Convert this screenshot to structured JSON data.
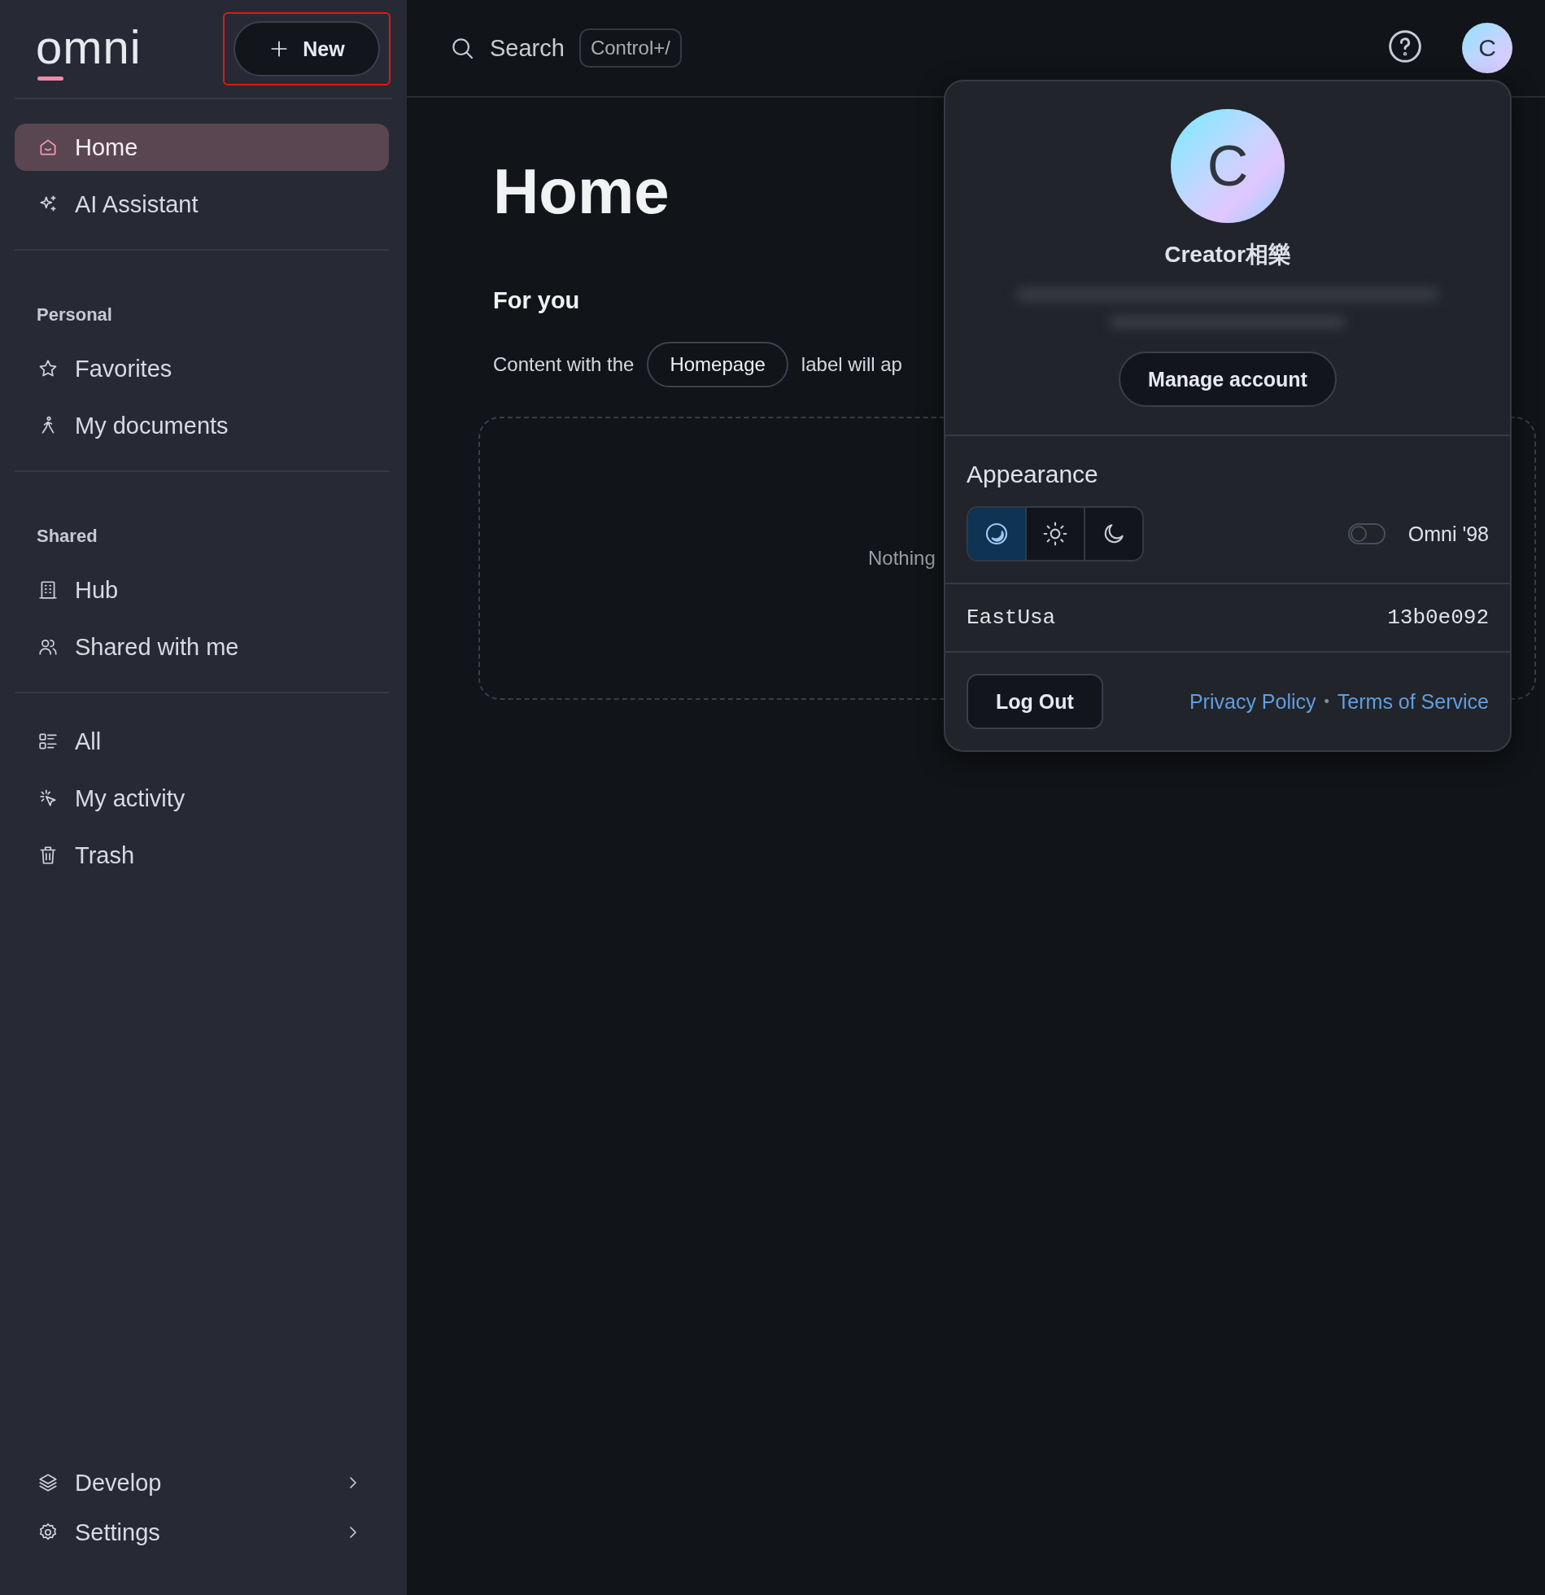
{
  "logo": {
    "text": "omni"
  },
  "new_button": {
    "label": "New",
    "highlighted": true
  },
  "search": {
    "label": "Search",
    "shortcut": "Control+/"
  },
  "user_avatar": {
    "initial": "C"
  },
  "sidebar": {
    "sections": [
      {
        "items": [
          {
            "label": "Home",
            "selected": true
          },
          {
            "label": "AI Assistant",
            "selected": false
          }
        ]
      },
      {
        "heading": "Personal",
        "items": [
          {
            "label": "Favorites",
            "selected": false
          },
          {
            "label": "My documents",
            "selected": false
          }
        ]
      },
      {
        "heading": "Shared",
        "items": [
          {
            "label": "Hub",
            "selected": false
          },
          {
            "label": "Shared with me",
            "selected": false
          }
        ]
      },
      {
        "items": [
          {
            "label": "All",
            "selected": false
          },
          {
            "label": "My activity",
            "selected": false
          },
          {
            "label": "Trash",
            "selected": false
          }
        ]
      }
    ],
    "footer_items": [
      {
        "label": "Develop",
        "expanded": false
      },
      {
        "label": "Settings",
        "expanded": false
      }
    ]
  },
  "main": {
    "title": "Home",
    "section_title": "For you",
    "hint_before": "Content with the",
    "hint_label": "Homepage",
    "hint_after": "label will ap",
    "empty_text": "Nothing"
  },
  "account_menu": {
    "avatar_initial": "C",
    "name": "Creator相樂",
    "manage_button": "Manage account",
    "appearance": {
      "title": "Appearance",
      "modes": [
        {
          "selected": true
        },
        {
          "selected": false
        },
        {
          "selected": false
        }
      ],
      "retro_toggle": {
        "label": "Omni '98",
        "on": false
      }
    },
    "region": "EastUsa",
    "version": "13b0e092",
    "logout_button": "Log Out",
    "links": [
      "Privacy Policy",
      "Terms of Service"
    ],
    "link_separator": "•"
  }
}
